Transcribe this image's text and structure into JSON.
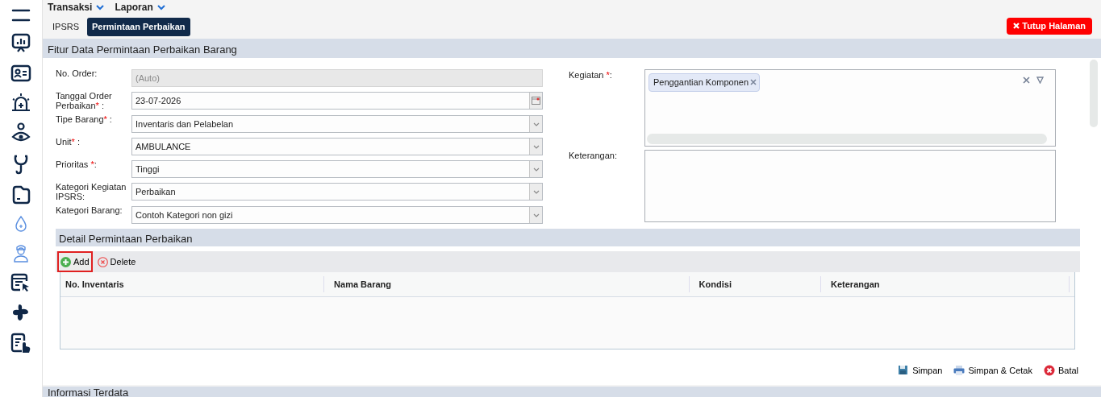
{
  "menus": [
    {
      "label": "Transaksi"
    },
    {
      "label": "Laporan"
    }
  ],
  "tabs": [
    {
      "label": "IPSRS",
      "selected": false
    },
    {
      "label": "Permintaan Perbaikan",
      "selected": true
    }
  ],
  "close_button": {
    "label": "Tutup Halaman"
  },
  "section_title": "Fitur Data Permintaan Perbaikan Barang",
  "form_left": [
    {
      "label": "No. Order",
      "suffix": ":",
      "kind": "readonly",
      "placeholder": "(Auto)"
    },
    {
      "label": "Tanggal Order Perbaikan",
      "required_mark": "*",
      "suffix": " :",
      "kind": "date",
      "value": "23-07-2026"
    },
    {
      "label": "Tipe Barang",
      "required_mark": "*",
      "suffix": " :",
      "kind": "select",
      "value": "Inventaris dan Pelabelan"
    },
    {
      "label": "Unit",
      "required_mark": "*",
      "suffix": " :",
      "kind": "select",
      "value": "AMBULANCE"
    },
    {
      "label": "Prioritas ",
      "required_mark": "*",
      "suffix": ":",
      "kind": "select",
      "value": "Tinggi"
    },
    {
      "label": "Kategori Kegiatan IPSRS",
      "suffix": ":",
      "kind": "select",
      "value": "Perbaikan"
    },
    {
      "label": "Kategori Barang",
      "suffix": ":",
      "kind": "select",
      "value": "Contoh Kategori non gizi"
    }
  ],
  "kegiatan": {
    "label": "Kegiatan ",
    "required_mark": "*",
    "suffix": ":",
    "tags": [
      "Penggantian Komponen"
    ]
  },
  "keterangan": {
    "label": "Keterangan:"
  },
  "detail": {
    "title": "Detail Permintaan Perbaikan",
    "toolbar": [
      {
        "label": "Add",
        "kind": "add",
        "highlighted": true
      },
      {
        "label": "Delete",
        "kind": "delete",
        "highlighted": false
      }
    ],
    "columns": [
      "No. Inventaris",
      "Nama Barang",
      "Kondisi",
      "Keterangan"
    ]
  },
  "actions": [
    {
      "label": "Simpan",
      "kind": "save"
    },
    {
      "label": "Simpan & Cetak",
      "kind": "print"
    },
    {
      "label": "Batal",
      "kind": "cancel"
    }
  ],
  "next_section_title": "Informasi Terdata"
}
